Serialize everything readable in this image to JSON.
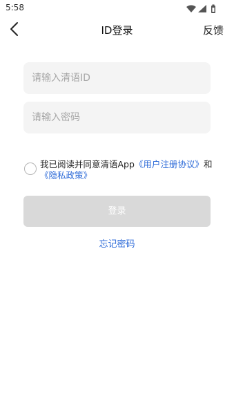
{
  "status_bar": {
    "time": "5:58",
    "icons": [
      "wifi-icon",
      "cellular-signal-icon",
      "battery-icon"
    ]
  },
  "header": {
    "back_icon": "chevron-left-icon",
    "title": "ID登录",
    "feedback_label": "反馈"
  },
  "form": {
    "id_placeholder": "请输入清语ID",
    "id_value": "",
    "password_placeholder": "请输入密码",
    "password_value": ""
  },
  "agreement": {
    "checked": false,
    "prefix": "我已阅读并同意清语App",
    "user_agreement": "《用户注册协议》",
    "conjunction": "和",
    "privacy_policy": "《隐私政策》"
  },
  "login_button": {
    "label": "登录",
    "enabled": false
  },
  "forgot_password": "忘记密码",
  "colors": {
    "link": "#2c6ad8",
    "input_bg": "#f4f4f4",
    "button_disabled": "#d9d9d9"
  }
}
